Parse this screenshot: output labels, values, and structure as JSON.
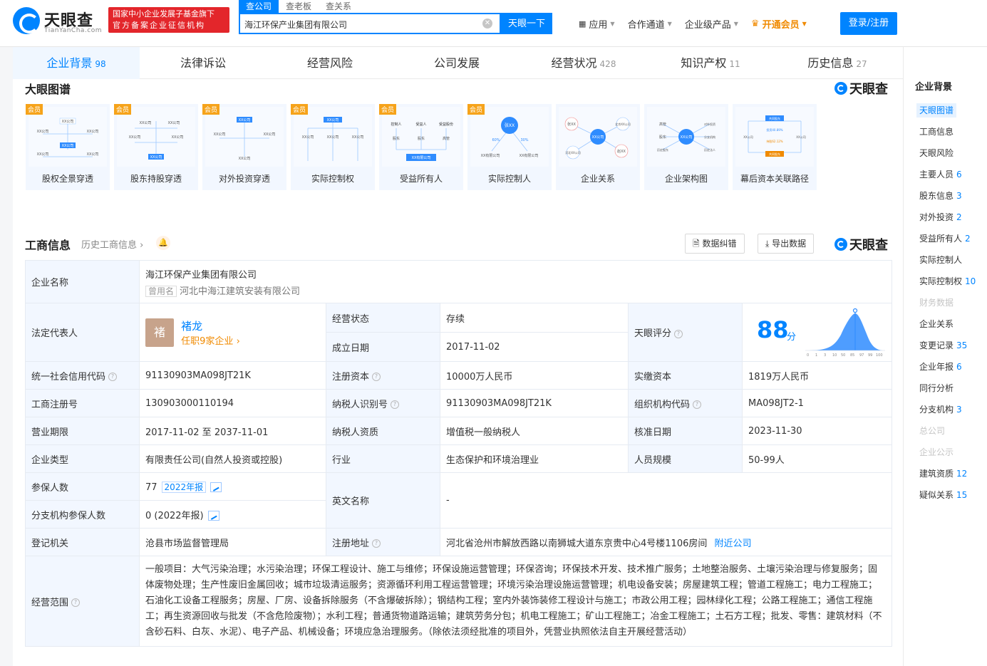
{
  "header": {
    "logo_text": "天眼查",
    "logo_sub": "TianYanCha.com",
    "promo_line1": "国家中小企业发展子基金旗下",
    "promo_line2": "官方备案企业征信机构",
    "search_tabs": [
      "查公司",
      "查老板",
      "查关系"
    ],
    "search_value": "海江环保产业集团有限公司",
    "search_button": "天眼一下",
    "menu": [
      "应用",
      "合作通道",
      "企业级产品",
      "开通会员"
    ],
    "login": "登录/注册"
  },
  "tabs": [
    {
      "label": "企业背景",
      "count": "98"
    },
    {
      "label": "法律诉讼",
      "count": ""
    },
    {
      "label": "经营风险",
      "count": ""
    },
    {
      "label": "公司发展",
      "count": ""
    },
    {
      "label": "经营状况",
      "count": "428"
    },
    {
      "label": "知识产权",
      "count": "11"
    },
    {
      "label": "历史信息",
      "count": "27"
    }
  ],
  "graph_section": {
    "title": "大眼图谱",
    "brand": "天眼查",
    "member_badge": "会员",
    "cards": [
      "股权全景穿透",
      "股东持股穿透",
      "对外投资穿透",
      "实际控制权",
      "受益所有人",
      "实际控制人",
      "企业关系",
      "企业架构图",
      "幕后资本关联路径"
    ],
    "thumb_text": {
      "company": "XX公司",
      "xx_limited": "XX有限公司",
      "person": "张XX",
      "control": "控制人",
      "beneficiary": "受益人",
      "benefit_share": "受益股份",
      "shareholder": "股东",
      "executive": "高管",
      "xx_company_short": "XX公司",
      "beijing_company": "北京XX公司",
      "hebei_company": "河北XX公司",
      "zhao": "赵XX",
      "historical_shareholder": "历史股东",
      "historical_legal": "历史法人",
      "foreign_invest": "对外投资",
      "branch": "分支机构",
      "common_holding": "共同股东",
      "investment_pct": "投资40.89%",
      "holding_pct": "持股62.12%",
      "pct_60": "60%",
      "pct_30": "30%"
    }
  },
  "gs_section": {
    "title": "工商信息",
    "history_link": "历史工商信息",
    "btn_correct": "数据纠错",
    "btn_export": "导出数据",
    "brand": "天眼查"
  },
  "info": {
    "company_name_k": "企业名称",
    "company_name": "海江环保产业集团有限公司",
    "former_tag": "曾用名",
    "former_name": "河北中海江建筑安装有限公司",
    "legal_rep_k": "法定代表人",
    "avatar_char": "褚",
    "legal_rep": "褚龙",
    "legal_rep_sub": "任职9家企业",
    "status_k": "经营状态",
    "status": "存续",
    "found_k": "成立日期",
    "found": "2017-11-02",
    "score_k": "天眼评分",
    "score": "88",
    "score_unit": "分",
    "score_axis": [
      "0",
      "1",
      "3",
      "10",
      "50",
      "85",
      "97",
      "99",
      "100"
    ],
    "credit_k": "统一社会信用代码",
    "credit": "91130903MA098JT21K",
    "reg_capital_k": "注册资本",
    "reg_capital": "10000万人民币",
    "paid_capital_k": "实缴资本",
    "paid_capital": "1819万人民币",
    "reg_no_k": "工商注册号",
    "reg_no": "130903000110194",
    "tax_id_k": "纳税人识别号",
    "tax_id": "91130903MA098JT21K",
    "org_code_k": "组织机构代码",
    "org_code": "MA098JT2-1",
    "term_k": "营业期限",
    "term": "2017-11-02 至 2037-11-01",
    "taxpayer_k": "纳税人资质",
    "taxpayer": "增值税一般纳税人",
    "approve_k": "核准日期",
    "approve": "2023-11-30",
    "type_k": "企业类型",
    "type": "有限责任公司(自然人投资或控股)",
    "industry_k": "行业",
    "industry": "生态保护和环境治理业",
    "staff_k": "人员规模",
    "staff": "50-99人",
    "insured_k": "参保人数",
    "insured": "77",
    "insured_tag": "2022年报",
    "en_name_k": "英文名称",
    "en_name": "-",
    "branch_insured_k": "分支机构参保人数",
    "branch_insured": "0 (2022年报)",
    "authority_k": "登记机关",
    "authority": "沧县市场监督管理局",
    "address_k": "注册地址",
    "address": "河北省沧州市解放西路以南狮城大道东京贵中心4号楼1106房间",
    "nearby": "附近公司",
    "scope_k": "经营范围",
    "scope": "一般项目：大气污染治理；水污染治理；环保工程设计、施工与维修；环保设施运营管理；环保咨询；环保技术开发、技术推广服务；土地整治服务、土壤污染治理与修复服务；固体废物处理；生产性废旧金属回收；城市垃圾清运服务；资源循环利用工程运营管理；环境污染治理设施运营管理；机电设备安装；房屋建筑工程；管道工程施工；电力工程施工；石油化工设备工程服务；房屋、厂房、设备拆除服务（不含爆破拆除）；钢结构工程；室内外装饰装修工程设计与施工；市政公用工程；园林绿化工程；公路工程施工；通信工程施工；再生资源回收与批发（不含危险废物）；水利工程；普通货物道路运输；建筑劳务分包；机电工程施工；矿山工程施工；冶金工程施工；土石方工程；批发、零售：建筑材料（不含砂石料、白灰、水泥）、电子产品、机械设备；环境应急治理服务。（除依法须经批准的项目外，凭营业执照依法自主开展经营活动）"
  },
  "sidebar": {
    "title": "企业背景",
    "items": [
      {
        "label": "天眼图谱",
        "n": "",
        "state": "active"
      },
      {
        "label": "工商信息",
        "n": "",
        "state": ""
      },
      {
        "label": "天眼风险",
        "n": "",
        "state": ""
      },
      {
        "label": "主要人员",
        "n": "6",
        "state": ""
      },
      {
        "label": "股东信息",
        "n": "3",
        "state": ""
      },
      {
        "label": "对外投资",
        "n": "2",
        "state": ""
      },
      {
        "label": "受益所有人",
        "n": "2",
        "state": ""
      },
      {
        "label": "实际控制人",
        "n": "",
        "state": ""
      },
      {
        "label": "实际控制权",
        "n": "10",
        "state": ""
      },
      {
        "label": "财务数据",
        "n": "",
        "state": "disabled"
      },
      {
        "label": "企业关系",
        "n": "",
        "state": ""
      },
      {
        "label": "变更记录",
        "n": "35",
        "state": ""
      },
      {
        "label": "企业年报",
        "n": "6",
        "state": ""
      },
      {
        "label": "同行分析",
        "n": "",
        "state": ""
      },
      {
        "label": "分支机构",
        "n": "3",
        "state": ""
      },
      {
        "label": "总公司",
        "n": "",
        "state": "disabled"
      },
      {
        "label": "企业公示",
        "n": "",
        "state": "disabled"
      },
      {
        "label": "建筑资质",
        "n": "12",
        "state": ""
      },
      {
        "label": "疑似关系",
        "n": "15",
        "state": ""
      }
    ]
  },
  "colors": {
    "brand": "#0084ff",
    "promo": "#e3262b",
    "vip": "#f08a00",
    "status": "#1fa55a"
  }
}
